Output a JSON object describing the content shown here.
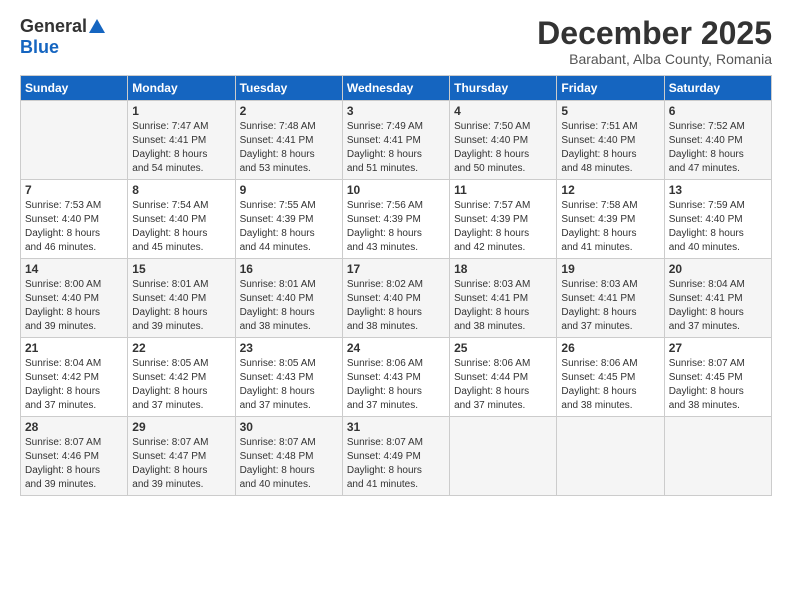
{
  "header": {
    "logo_general": "General",
    "logo_blue": "Blue",
    "month_title": "December 2025",
    "location": "Barabant, Alba County, Romania"
  },
  "days_of_week": [
    "Sunday",
    "Monday",
    "Tuesday",
    "Wednesday",
    "Thursday",
    "Friday",
    "Saturday"
  ],
  "weeks": [
    [
      {
        "day": "",
        "info": ""
      },
      {
        "day": "1",
        "info": "Sunrise: 7:47 AM\nSunset: 4:41 PM\nDaylight: 8 hours\nand 54 minutes."
      },
      {
        "day": "2",
        "info": "Sunrise: 7:48 AM\nSunset: 4:41 PM\nDaylight: 8 hours\nand 53 minutes."
      },
      {
        "day": "3",
        "info": "Sunrise: 7:49 AM\nSunset: 4:41 PM\nDaylight: 8 hours\nand 51 minutes."
      },
      {
        "day": "4",
        "info": "Sunrise: 7:50 AM\nSunset: 4:40 PM\nDaylight: 8 hours\nand 50 minutes."
      },
      {
        "day": "5",
        "info": "Sunrise: 7:51 AM\nSunset: 4:40 PM\nDaylight: 8 hours\nand 48 minutes."
      },
      {
        "day": "6",
        "info": "Sunrise: 7:52 AM\nSunset: 4:40 PM\nDaylight: 8 hours\nand 47 minutes."
      }
    ],
    [
      {
        "day": "7",
        "info": "Sunrise: 7:53 AM\nSunset: 4:40 PM\nDaylight: 8 hours\nand 46 minutes."
      },
      {
        "day": "8",
        "info": "Sunrise: 7:54 AM\nSunset: 4:40 PM\nDaylight: 8 hours\nand 45 minutes."
      },
      {
        "day": "9",
        "info": "Sunrise: 7:55 AM\nSunset: 4:39 PM\nDaylight: 8 hours\nand 44 minutes."
      },
      {
        "day": "10",
        "info": "Sunrise: 7:56 AM\nSunset: 4:39 PM\nDaylight: 8 hours\nand 43 minutes."
      },
      {
        "day": "11",
        "info": "Sunrise: 7:57 AM\nSunset: 4:39 PM\nDaylight: 8 hours\nand 42 minutes."
      },
      {
        "day": "12",
        "info": "Sunrise: 7:58 AM\nSunset: 4:39 PM\nDaylight: 8 hours\nand 41 minutes."
      },
      {
        "day": "13",
        "info": "Sunrise: 7:59 AM\nSunset: 4:40 PM\nDaylight: 8 hours\nand 40 minutes."
      }
    ],
    [
      {
        "day": "14",
        "info": "Sunrise: 8:00 AM\nSunset: 4:40 PM\nDaylight: 8 hours\nand 39 minutes."
      },
      {
        "day": "15",
        "info": "Sunrise: 8:01 AM\nSunset: 4:40 PM\nDaylight: 8 hours\nand 39 minutes."
      },
      {
        "day": "16",
        "info": "Sunrise: 8:01 AM\nSunset: 4:40 PM\nDaylight: 8 hours\nand 38 minutes."
      },
      {
        "day": "17",
        "info": "Sunrise: 8:02 AM\nSunset: 4:40 PM\nDaylight: 8 hours\nand 38 minutes."
      },
      {
        "day": "18",
        "info": "Sunrise: 8:03 AM\nSunset: 4:41 PM\nDaylight: 8 hours\nand 38 minutes."
      },
      {
        "day": "19",
        "info": "Sunrise: 8:03 AM\nSunset: 4:41 PM\nDaylight: 8 hours\nand 37 minutes."
      },
      {
        "day": "20",
        "info": "Sunrise: 8:04 AM\nSunset: 4:41 PM\nDaylight: 8 hours\nand 37 minutes."
      }
    ],
    [
      {
        "day": "21",
        "info": "Sunrise: 8:04 AM\nSunset: 4:42 PM\nDaylight: 8 hours\nand 37 minutes."
      },
      {
        "day": "22",
        "info": "Sunrise: 8:05 AM\nSunset: 4:42 PM\nDaylight: 8 hours\nand 37 minutes."
      },
      {
        "day": "23",
        "info": "Sunrise: 8:05 AM\nSunset: 4:43 PM\nDaylight: 8 hours\nand 37 minutes."
      },
      {
        "day": "24",
        "info": "Sunrise: 8:06 AM\nSunset: 4:43 PM\nDaylight: 8 hours\nand 37 minutes."
      },
      {
        "day": "25",
        "info": "Sunrise: 8:06 AM\nSunset: 4:44 PM\nDaylight: 8 hours\nand 37 minutes."
      },
      {
        "day": "26",
        "info": "Sunrise: 8:06 AM\nSunset: 4:45 PM\nDaylight: 8 hours\nand 38 minutes."
      },
      {
        "day": "27",
        "info": "Sunrise: 8:07 AM\nSunset: 4:45 PM\nDaylight: 8 hours\nand 38 minutes."
      }
    ],
    [
      {
        "day": "28",
        "info": "Sunrise: 8:07 AM\nSunset: 4:46 PM\nDaylight: 8 hours\nand 39 minutes."
      },
      {
        "day": "29",
        "info": "Sunrise: 8:07 AM\nSunset: 4:47 PM\nDaylight: 8 hours\nand 39 minutes."
      },
      {
        "day": "30",
        "info": "Sunrise: 8:07 AM\nSunset: 4:48 PM\nDaylight: 8 hours\nand 40 minutes."
      },
      {
        "day": "31",
        "info": "Sunrise: 8:07 AM\nSunset: 4:49 PM\nDaylight: 8 hours\nand 41 minutes."
      },
      {
        "day": "",
        "info": ""
      },
      {
        "day": "",
        "info": ""
      },
      {
        "day": "",
        "info": ""
      }
    ]
  ]
}
